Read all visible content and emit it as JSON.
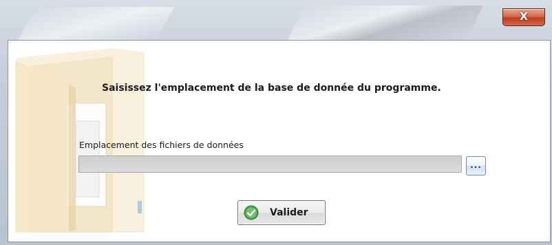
{
  "window": {
    "close_label": "X"
  },
  "dialog": {
    "prompt": "Saisissez l'emplacement de la base de donnée du programme.",
    "field_label": "Emplacement des fichiers de données",
    "path_value": "",
    "browse_label": "...",
    "validate_label": "Valider"
  },
  "icons": {
    "folder": "folder-icon",
    "check": "checkmark-icon",
    "close": "close-icon"
  },
  "colors": {
    "close_button": "#c8502f",
    "check_green": "#3aa03a",
    "folder_tint": "#f6ead0"
  }
}
